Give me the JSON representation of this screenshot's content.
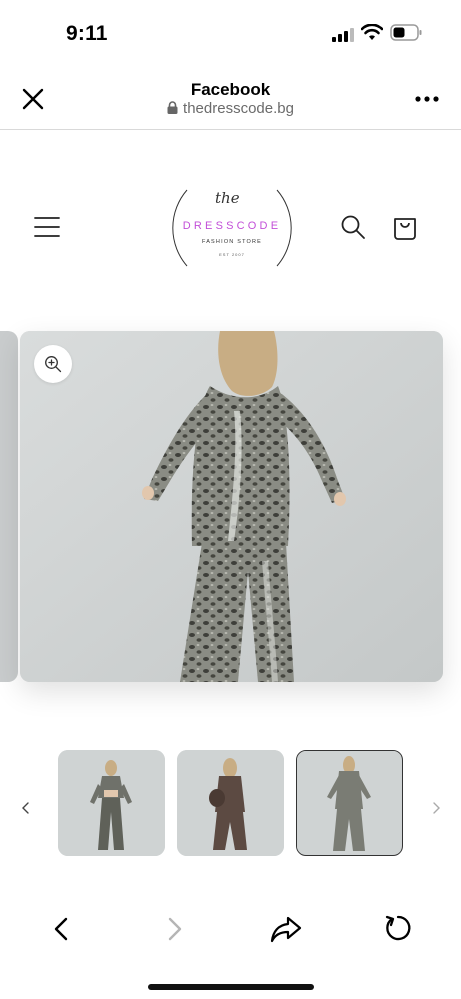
{
  "status_bar": {
    "time": "9:11"
  },
  "browser": {
    "title": "Facebook",
    "url": "thedresscode.bg",
    "icons": {
      "close": "close-icon",
      "lock": "lock-icon",
      "more": "more-icon"
    }
  },
  "site": {
    "logo": {
      "script": "the",
      "brand": "DRESSCODE",
      "tagline": "FASHION STORE",
      "est": "EST 2007"
    },
    "icons": {
      "menu": "menu-icon",
      "search": "search-icon",
      "cart": "bag-icon"
    }
  },
  "gallery": {
    "thumbnails": [
      {
        "label": "thumbnail-1",
        "selected": false
      },
      {
        "label": "thumbnail-2",
        "selected": false
      },
      {
        "label": "thumbnail-3",
        "selected": true
      }
    ]
  },
  "colors": {
    "brand_accent": "#c24fd8",
    "image_background": "#cfd3d3",
    "divider": "#d9d9d9"
  }
}
